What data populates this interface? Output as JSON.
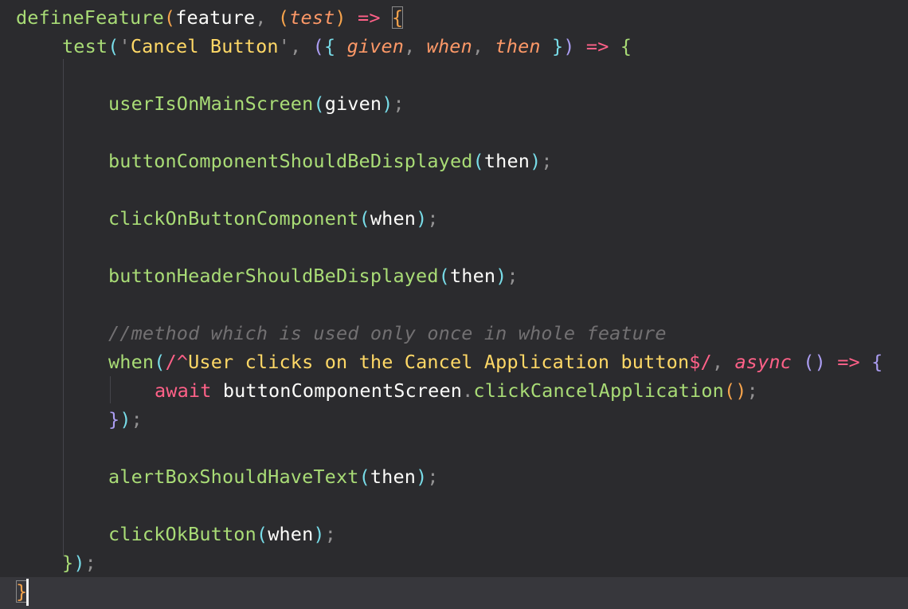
{
  "editor": {
    "lines": [
      {
        "indent": 0,
        "tokens": [
          {
            "t": "defineFeature",
            "c": "fn"
          },
          {
            "t": "(",
            "c": "p1"
          },
          {
            "t": "feature",
            "c": "id"
          },
          {
            "t": ", ",
            "c": "punct"
          },
          {
            "t": "(",
            "c": "p1"
          },
          {
            "t": "test",
            "c": "param"
          },
          {
            "t": ")",
            "c": "p1"
          },
          {
            "t": " ",
            "c": "id"
          },
          {
            "t": "=>",
            "c": "op"
          },
          {
            "t": " ",
            "c": "id"
          },
          {
            "t": "{",
            "c": "p1",
            "box": true
          }
        ]
      },
      {
        "indent": 1,
        "tokens": [
          {
            "t": "test",
            "c": "fn"
          },
          {
            "t": "(",
            "c": "p2"
          },
          {
            "t": "'",
            "c": "punct"
          },
          {
            "t": "Cancel Button",
            "c": "str"
          },
          {
            "t": "'",
            "c": "punct"
          },
          {
            "t": ", ",
            "c": "punct"
          },
          {
            "t": "(",
            "c": "p3"
          },
          {
            "t": "{ ",
            "c": "p2"
          },
          {
            "t": "given",
            "c": "param"
          },
          {
            "t": ", ",
            "c": "punct"
          },
          {
            "t": "when",
            "c": "param"
          },
          {
            "t": ", ",
            "c": "punct"
          },
          {
            "t": "then",
            "c": "param"
          },
          {
            "t": " }",
            "c": "p2"
          },
          {
            "t": ")",
            "c": "p3"
          },
          {
            "t": " ",
            "c": "id"
          },
          {
            "t": "=>",
            "c": "op"
          },
          {
            "t": " ",
            "c": "id"
          },
          {
            "t": "{",
            "c": "fnb"
          }
        ]
      },
      {
        "indent": 0,
        "tokens": []
      },
      {
        "indent": 2,
        "tokens": [
          {
            "t": "userIsOnMainScreen",
            "c": "fn"
          },
          {
            "t": "(",
            "c": "p2"
          },
          {
            "t": "given",
            "c": "id"
          },
          {
            "t": ")",
            "c": "p2"
          },
          {
            "t": ";",
            "c": "punct"
          }
        ]
      },
      {
        "indent": 0,
        "tokens": []
      },
      {
        "indent": 2,
        "tokens": [
          {
            "t": "buttonComponentShouldBeDisplayed",
            "c": "fn"
          },
          {
            "t": "(",
            "c": "p2"
          },
          {
            "t": "then",
            "c": "id"
          },
          {
            "t": ")",
            "c": "p2"
          },
          {
            "t": ";",
            "c": "punct"
          }
        ]
      },
      {
        "indent": 0,
        "tokens": []
      },
      {
        "indent": 2,
        "tokens": [
          {
            "t": "clickOnButtonComponent",
            "c": "fn"
          },
          {
            "t": "(",
            "c": "p2"
          },
          {
            "t": "when",
            "c": "id"
          },
          {
            "t": ")",
            "c": "p2"
          },
          {
            "t": ";",
            "c": "punct"
          }
        ]
      },
      {
        "indent": 0,
        "tokens": []
      },
      {
        "indent": 2,
        "tokens": [
          {
            "t": "buttonHeaderShouldBeDisplayed",
            "c": "fn"
          },
          {
            "t": "(",
            "c": "p2"
          },
          {
            "t": "then",
            "c": "id"
          },
          {
            "t": ")",
            "c": "p2"
          },
          {
            "t": ";",
            "c": "punct"
          }
        ]
      },
      {
        "indent": 0,
        "tokens": []
      },
      {
        "indent": 2,
        "tokens": [
          {
            "t": "//method which is used only once in whole feature",
            "c": "comment"
          }
        ]
      },
      {
        "indent": 2,
        "tokens": [
          {
            "t": "when",
            "c": "fn"
          },
          {
            "t": "(",
            "c": "p2"
          },
          {
            "t": "/^",
            "c": "op"
          },
          {
            "t": "User clicks on the Cancel Application button",
            "c": "str"
          },
          {
            "t": "$/",
            "c": "op"
          },
          {
            "t": ", ",
            "c": "punct"
          },
          {
            "t": "async",
            "c": "kwi"
          },
          {
            "t": " ",
            "c": "id"
          },
          {
            "t": "()",
            "c": "p3"
          },
          {
            "t": " ",
            "c": "id"
          },
          {
            "t": "=>",
            "c": "op"
          },
          {
            "t": " ",
            "c": "id"
          },
          {
            "t": "{",
            "c": "p3"
          }
        ]
      },
      {
        "indent": 3,
        "tokens": [
          {
            "t": "await",
            "c": "kw"
          },
          {
            "t": " ",
            "c": "id"
          },
          {
            "t": "buttonComponentScreen",
            "c": "id"
          },
          {
            "t": ".",
            "c": "punct"
          },
          {
            "t": "clickCancelApplication",
            "c": "member"
          },
          {
            "t": "()",
            "c": "p1"
          },
          {
            "t": ";",
            "c": "punct"
          }
        ]
      },
      {
        "indent": 2,
        "tokens": [
          {
            "t": "}",
            "c": "p3"
          },
          {
            "t": ")",
            "c": "p2"
          },
          {
            "t": ";",
            "c": "punct"
          }
        ]
      },
      {
        "indent": 0,
        "tokens": []
      },
      {
        "indent": 2,
        "tokens": [
          {
            "t": "alertBoxShouldHaveText",
            "c": "fn"
          },
          {
            "t": "(",
            "c": "p2"
          },
          {
            "t": "then",
            "c": "id"
          },
          {
            "t": ")",
            "c": "p2"
          },
          {
            "t": ";",
            "c": "punct"
          }
        ]
      },
      {
        "indent": 0,
        "tokens": []
      },
      {
        "indent": 2,
        "tokens": [
          {
            "t": "clickOkButton",
            "c": "fn"
          },
          {
            "t": "(",
            "c": "p2"
          },
          {
            "t": "when",
            "c": "id"
          },
          {
            "t": ")",
            "c": "p2"
          },
          {
            "t": ";",
            "c": "punct"
          }
        ]
      },
      {
        "indent": 1,
        "tokens": [
          {
            "t": "}",
            "c": "fnb"
          },
          {
            "t": ")",
            "c": "p2"
          },
          {
            "t": ";",
            "c": "punct"
          }
        ]
      },
      {
        "indent": 0,
        "tokens": [
          {
            "t": "}",
            "c": "p1",
            "box": true
          }
        ]
      }
    ]
  }
}
